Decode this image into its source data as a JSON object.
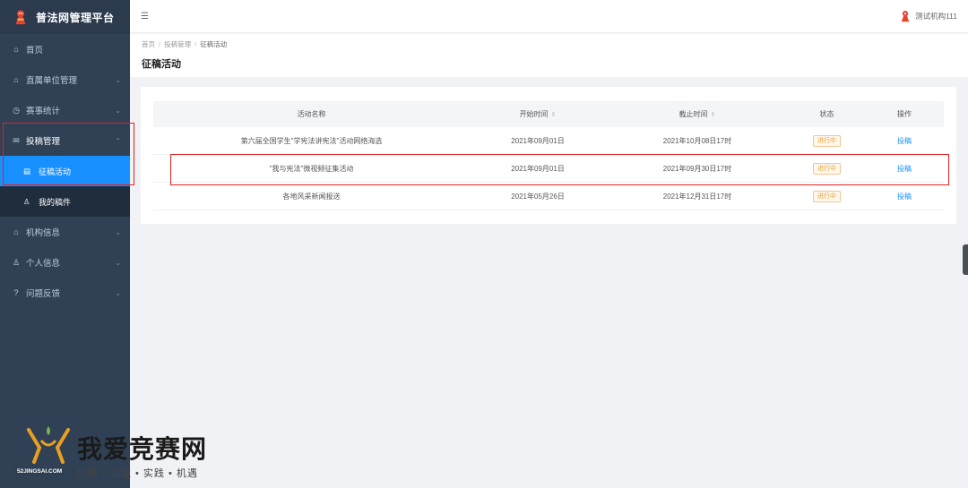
{
  "app": {
    "title": "普法网管理平台"
  },
  "sidebar": {
    "items": [
      {
        "label": "首页",
        "icon": "home-icon",
        "arrow": ""
      },
      {
        "label": "直属单位管理",
        "icon": "home-icon",
        "arrow": "⌄"
      },
      {
        "label": "赛事统计",
        "icon": "clock-icon",
        "arrow": "⌄"
      },
      {
        "label": "投稿管理",
        "icon": "mail-icon",
        "arrow": "⌃"
      },
      {
        "label": "机构信息",
        "icon": "bank-icon",
        "arrow": "⌄"
      },
      {
        "label": "个人信息",
        "icon": "user-icon",
        "arrow": "⌄"
      },
      {
        "label": "问题反馈",
        "icon": "help-icon",
        "arrow": "⌄"
      }
    ],
    "sub_items": [
      {
        "label": "征稿活动",
        "icon": "document-icon"
      },
      {
        "label": "我的稿件",
        "icon": "user-icon"
      }
    ]
  },
  "header": {
    "menu_icon": "hamburger-icon",
    "user_name": "测试机构111"
  },
  "breadcrumb": {
    "items": [
      "首页",
      "投稿管理",
      "征稿活动"
    ]
  },
  "page_title": "征稿活动",
  "table": {
    "columns": [
      "活动名称",
      "开始时间",
      "截止时间",
      "状态",
      "操作"
    ],
    "rows": [
      {
        "name": "第六届全国学生\"学宪法讲宪法\"活动网络海选",
        "start": "2021年09月01日",
        "end": "2021年10月08日17时",
        "status": "进行中",
        "action": "投稿"
      },
      {
        "name": "\"我与宪法\"微视频征集活动",
        "start": "2021年09月01日",
        "end": "2021年09月30日17时",
        "status": "进行中",
        "action": "投稿"
      },
      {
        "name": "各地风采新闻报送",
        "start": "2021年05月26日",
        "end": "2021年12月31日17时",
        "status": "进行中",
        "action": "投稿"
      }
    ]
  },
  "watermark": {
    "title": "我爱竞赛网",
    "url": "52JINGSAI.COM",
    "tagline": "比赛 • 公益 • 实践 • 机遇"
  },
  "colors": {
    "sidebar_bg": "#304156",
    "active": "#1890ff",
    "status": "#e6a23c",
    "highlight_box": "#e02020"
  }
}
